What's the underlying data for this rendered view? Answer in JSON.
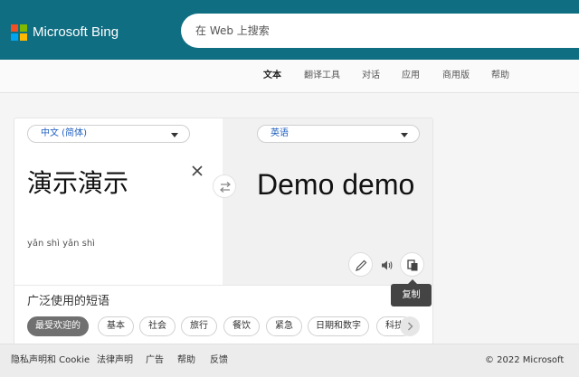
{
  "header": {
    "brand": "Microsoft Bing",
    "search_placeholder": "在 Web 上搜索",
    "colors": {
      "header_bg": "#0f6e82"
    }
  },
  "nav": [
    "文本",
    "翻译工具",
    "对话",
    "应用",
    "商用版",
    "帮助"
  ],
  "translator": {
    "source_lang": "中文 (简体)",
    "target_lang": "英语",
    "source_text": "演示演示",
    "pinyin": "yǎn shì yǎn shì",
    "target_text": "Demo demo",
    "copy_tooltip": "复制",
    "icons": [
      "close-icon",
      "swap-icon",
      "pencil-icon",
      "speaker-icon",
      "copy-icon"
    ]
  },
  "phrases": {
    "title": "广泛使用的短语",
    "categories": [
      "最受欢迎的",
      "基本",
      "社会",
      "旅行",
      "餐饮",
      "紧急",
      "日期和数字",
      "科技"
    ]
  },
  "footer": {
    "links": [
      "隐私声明和 Cookie",
      "法律声明",
      "广告",
      "帮助",
      "反馈"
    ],
    "copyright": "© 2022 Microsoft"
  }
}
